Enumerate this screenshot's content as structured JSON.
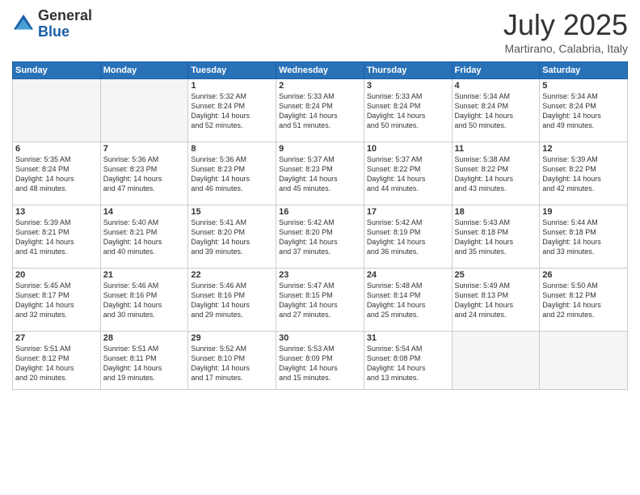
{
  "header": {
    "logo_line1": "General",
    "logo_line2": "Blue",
    "month": "July 2025",
    "location": "Martirano, Calabria, Italy"
  },
  "weekdays": [
    "Sunday",
    "Monday",
    "Tuesday",
    "Wednesday",
    "Thursday",
    "Friday",
    "Saturday"
  ],
  "weeks": [
    [
      {
        "day": "",
        "info": ""
      },
      {
        "day": "",
        "info": ""
      },
      {
        "day": "1",
        "info": "Sunrise: 5:32 AM\nSunset: 8:24 PM\nDaylight: 14 hours\nand 52 minutes."
      },
      {
        "day": "2",
        "info": "Sunrise: 5:33 AM\nSunset: 8:24 PM\nDaylight: 14 hours\nand 51 minutes."
      },
      {
        "day": "3",
        "info": "Sunrise: 5:33 AM\nSunset: 8:24 PM\nDaylight: 14 hours\nand 50 minutes."
      },
      {
        "day": "4",
        "info": "Sunrise: 5:34 AM\nSunset: 8:24 PM\nDaylight: 14 hours\nand 50 minutes."
      },
      {
        "day": "5",
        "info": "Sunrise: 5:34 AM\nSunset: 8:24 PM\nDaylight: 14 hours\nand 49 minutes."
      }
    ],
    [
      {
        "day": "6",
        "info": "Sunrise: 5:35 AM\nSunset: 8:24 PM\nDaylight: 14 hours\nand 48 minutes."
      },
      {
        "day": "7",
        "info": "Sunrise: 5:36 AM\nSunset: 8:23 PM\nDaylight: 14 hours\nand 47 minutes."
      },
      {
        "day": "8",
        "info": "Sunrise: 5:36 AM\nSunset: 8:23 PM\nDaylight: 14 hours\nand 46 minutes."
      },
      {
        "day": "9",
        "info": "Sunrise: 5:37 AM\nSunset: 8:23 PM\nDaylight: 14 hours\nand 45 minutes."
      },
      {
        "day": "10",
        "info": "Sunrise: 5:37 AM\nSunset: 8:22 PM\nDaylight: 14 hours\nand 44 minutes."
      },
      {
        "day": "11",
        "info": "Sunrise: 5:38 AM\nSunset: 8:22 PM\nDaylight: 14 hours\nand 43 minutes."
      },
      {
        "day": "12",
        "info": "Sunrise: 5:39 AM\nSunset: 8:22 PM\nDaylight: 14 hours\nand 42 minutes."
      }
    ],
    [
      {
        "day": "13",
        "info": "Sunrise: 5:39 AM\nSunset: 8:21 PM\nDaylight: 14 hours\nand 41 minutes."
      },
      {
        "day": "14",
        "info": "Sunrise: 5:40 AM\nSunset: 8:21 PM\nDaylight: 14 hours\nand 40 minutes."
      },
      {
        "day": "15",
        "info": "Sunrise: 5:41 AM\nSunset: 8:20 PM\nDaylight: 14 hours\nand 39 minutes."
      },
      {
        "day": "16",
        "info": "Sunrise: 5:42 AM\nSunset: 8:20 PM\nDaylight: 14 hours\nand 37 minutes."
      },
      {
        "day": "17",
        "info": "Sunrise: 5:42 AM\nSunset: 8:19 PM\nDaylight: 14 hours\nand 36 minutes."
      },
      {
        "day": "18",
        "info": "Sunrise: 5:43 AM\nSunset: 8:18 PM\nDaylight: 14 hours\nand 35 minutes."
      },
      {
        "day": "19",
        "info": "Sunrise: 5:44 AM\nSunset: 8:18 PM\nDaylight: 14 hours\nand 33 minutes."
      }
    ],
    [
      {
        "day": "20",
        "info": "Sunrise: 5:45 AM\nSunset: 8:17 PM\nDaylight: 14 hours\nand 32 minutes."
      },
      {
        "day": "21",
        "info": "Sunrise: 5:46 AM\nSunset: 8:16 PM\nDaylight: 14 hours\nand 30 minutes."
      },
      {
        "day": "22",
        "info": "Sunrise: 5:46 AM\nSunset: 8:16 PM\nDaylight: 14 hours\nand 29 minutes."
      },
      {
        "day": "23",
        "info": "Sunrise: 5:47 AM\nSunset: 8:15 PM\nDaylight: 14 hours\nand 27 minutes."
      },
      {
        "day": "24",
        "info": "Sunrise: 5:48 AM\nSunset: 8:14 PM\nDaylight: 14 hours\nand 25 minutes."
      },
      {
        "day": "25",
        "info": "Sunrise: 5:49 AM\nSunset: 8:13 PM\nDaylight: 14 hours\nand 24 minutes."
      },
      {
        "day": "26",
        "info": "Sunrise: 5:50 AM\nSunset: 8:12 PM\nDaylight: 14 hours\nand 22 minutes."
      }
    ],
    [
      {
        "day": "27",
        "info": "Sunrise: 5:51 AM\nSunset: 8:12 PM\nDaylight: 14 hours\nand 20 minutes."
      },
      {
        "day": "28",
        "info": "Sunrise: 5:51 AM\nSunset: 8:11 PM\nDaylight: 14 hours\nand 19 minutes."
      },
      {
        "day": "29",
        "info": "Sunrise: 5:52 AM\nSunset: 8:10 PM\nDaylight: 14 hours\nand 17 minutes."
      },
      {
        "day": "30",
        "info": "Sunrise: 5:53 AM\nSunset: 8:09 PM\nDaylight: 14 hours\nand 15 minutes."
      },
      {
        "day": "31",
        "info": "Sunrise: 5:54 AM\nSunset: 8:08 PM\nDaylight: 14 hours\nand 13 minutes."
      },
      {
        "day": "",
        "info": ""
      },
      {
        "day": "",
        "info": ""
      }
    ]
  ]
}
